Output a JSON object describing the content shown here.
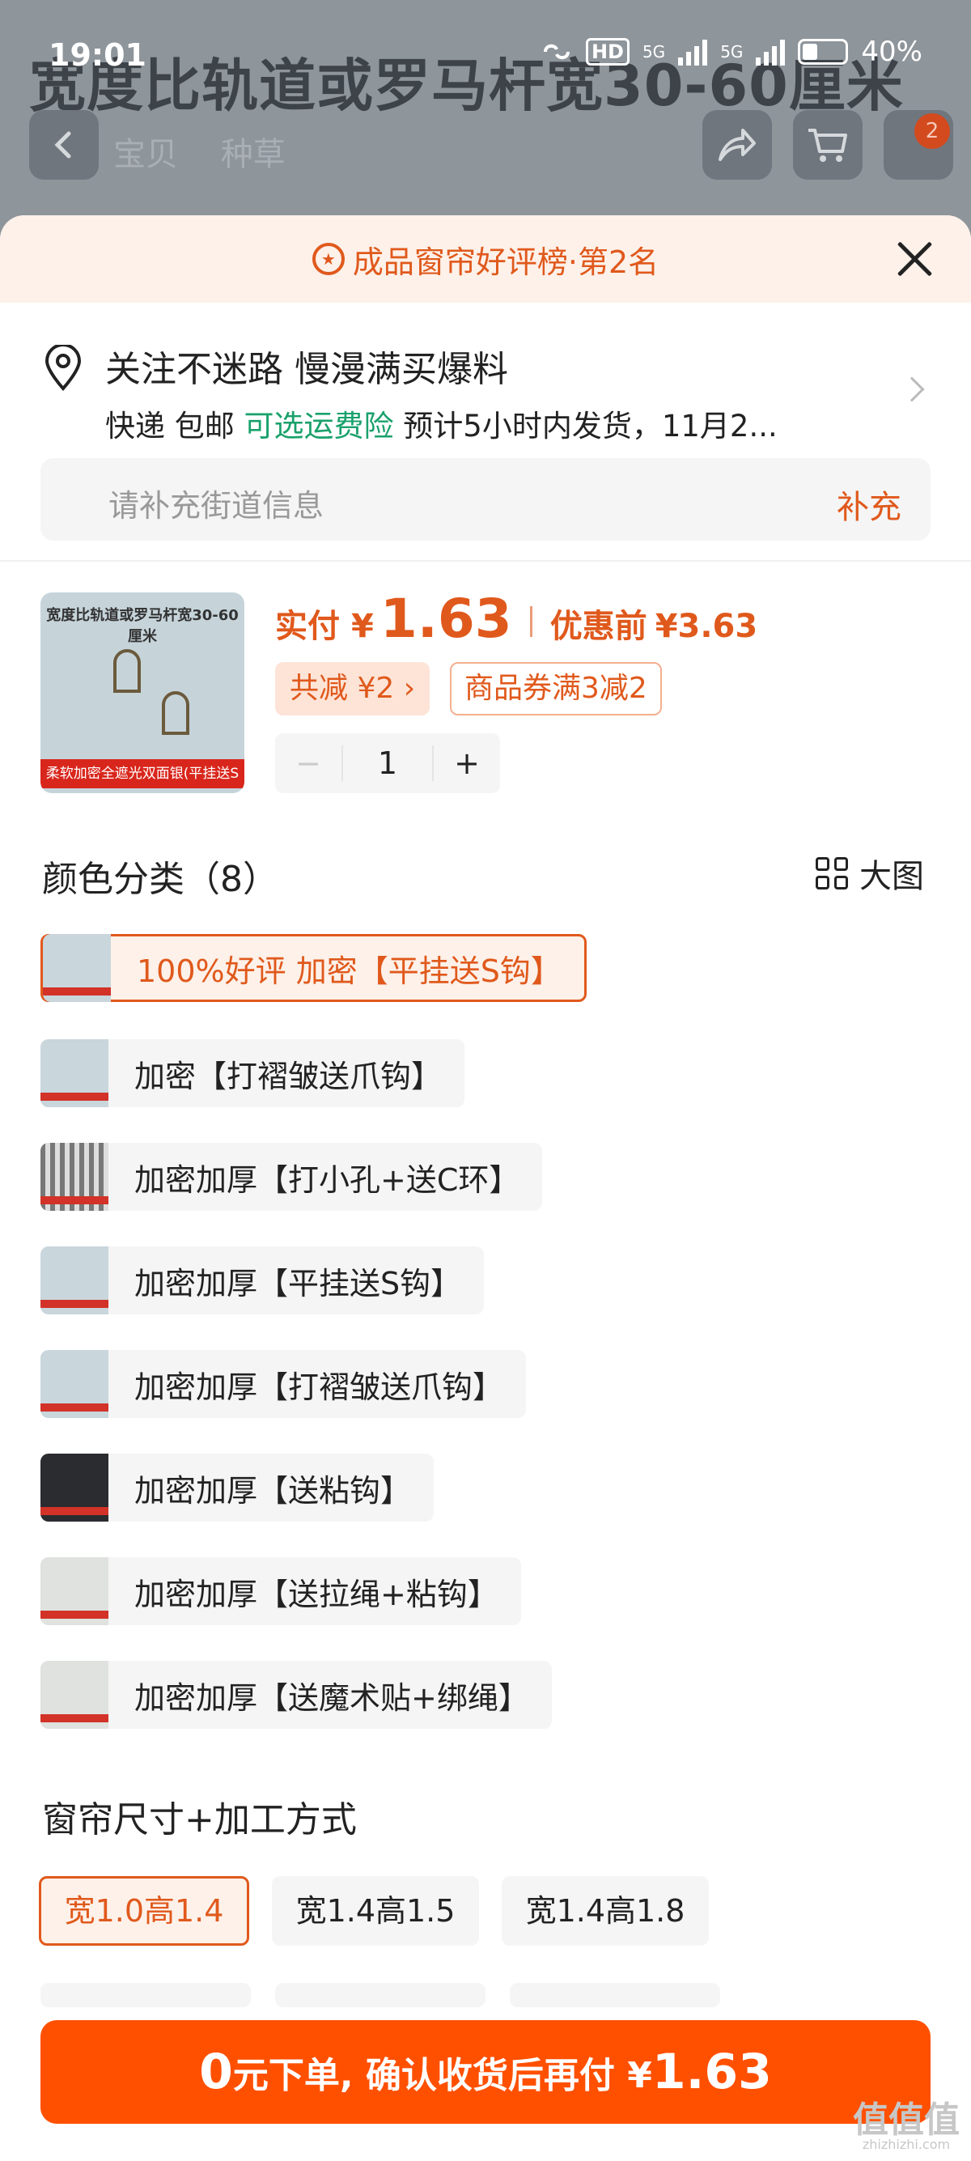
{
  "status_bar": {
    "time": "19:01",
    "hd": "HD",
    "net1": "5G",
    "net2": "5G",
    "battery": "40%"
  },
  "background": {
    "title": "宽度比轨道或罗马杆宽30-60厘米",
    "tabs": [
      "宝贝",
      "种草"
    ],
    "cart_badge": "2"
  },
  "rank_bar": {
    "text": "成品窗帘好评榜·第2名"
  },
  "address": {
    "line1": "关注不迷路 慢漫满买爆料",
    "courier": "快递 包邮",
    "insurance": "可选运费险",
    "delivery": "预计5小时内发货，11月2...",
    "input_placeholder": "请补充街道信息",
    "add_label": "补充"
  },
  "product": {
    "thumb_title": "宽度比轨道或罗马杆宽30-60厘米",
    "thumb_banner": "柔软加密全遮光双面银(平挂送S钩)",
    "paid_label": "实付",
    "currency": "¥",
    "price": "1.63",
    "before_label": "优惠前",
    "before_price": "¥3.63",
    "discount_chip": "共减 ¥2 ›",
    "coupon_chip": "商品券满3减2",
    "quantity": "1",
    "minus": "−",
    "plus": "+"
  },
  "color_section": {
    "title": "颜色分类（8）",
    "big_view": "大图",
    "options": [
      {
        "label": "100%好评  加密【平挂送S钩】",
        "selected": true
      },
      {
        "label": "加密【打褶皱送爪钩】",
        "selected": false
      },
      {
        "label": "加密加厚【打小孔+送C环】",
        "selected": false
      },
      {
        "label": "加密加厚【平挂送S钩】",
        "selected": false
      },
      {
        "label": "加密加厚【打褶皱送爪钩】",
        "selected": false
      },
      {
        "label": "加密加厚【送粘钩】",
        "selected": false
      },
      {
        "label": "加密加厚【送拉绳+粘钩】",
        "selected": false
      },
      {
        "label": "加密加厚【送魔术贴+绑绳】",
        "selected": false
      }
    ]
  },
  "size_section": {
    "title": "窗帘尺寸+加工方式",
    "options": [
      {
        "label": "宽1.0高1.4",
        "selected": true
      },
      {
        "label": "宽1.4高1.5",
        "selected": false
      },
      {
        "label": "宽1.4高1.8",
        "selected": false
      }
    ]
  },
  "cta": {
    "zero": "0",
    "text_a": "元下单, 确认收货后再付 ¥",
    "amount": "1.63"
  },
  "watermark": {
    "main": "值值值",
    "sub": "zhizhizhi.com"
  }
}
